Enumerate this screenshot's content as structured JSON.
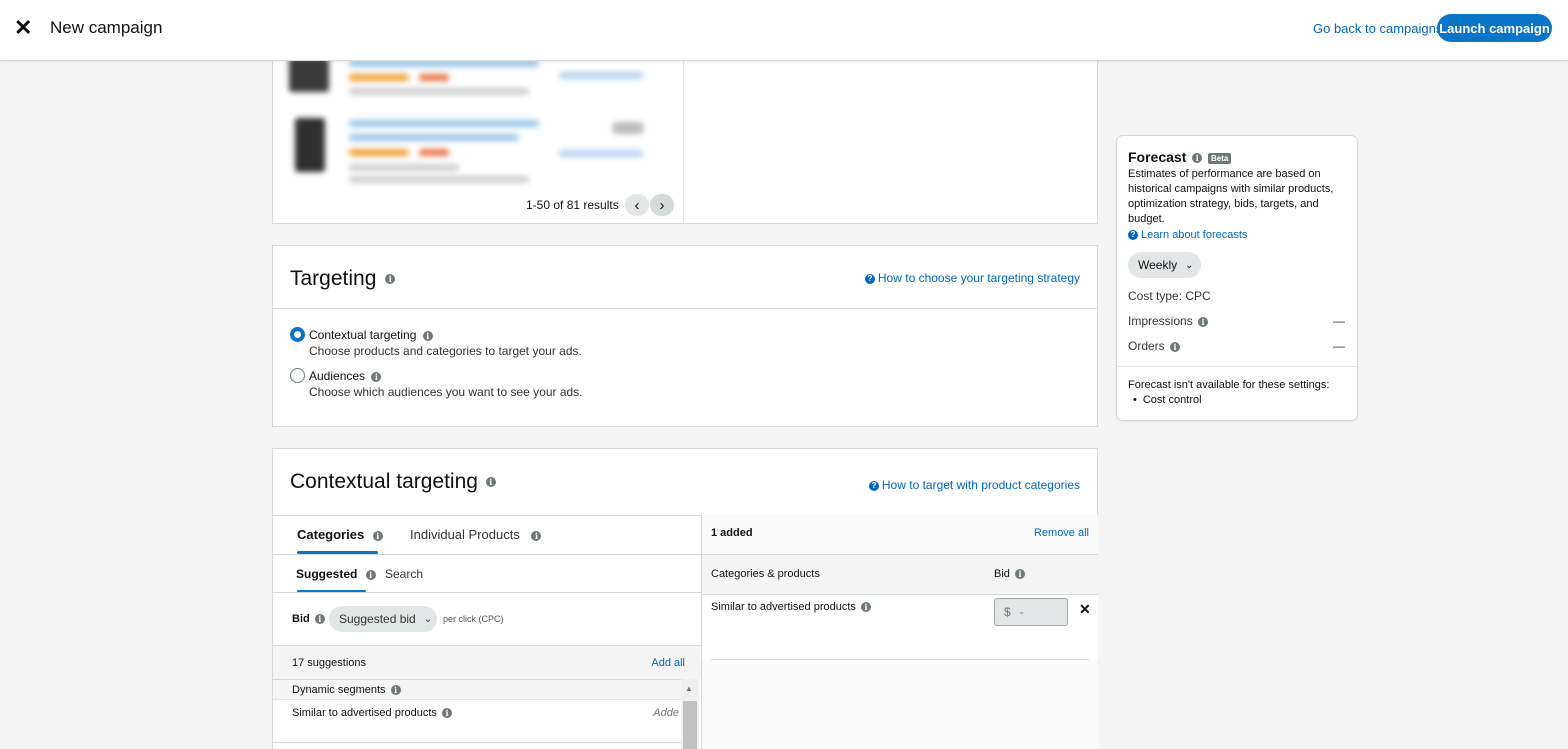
{
  "header": {
    "title": "New campaign",
    "go_back_label": "Go back to campaigns",
    "launch_label": "Launch campaign"
  },
  "products": {
    "pager_text": "1-50 of 81 results"
  },
  "targeting": {
    "title": "Targeting",
    "help_link": "How to choose your targeting strategy",
    "options": [
      {
        "label": "Contextual targeting",
        "desc": "Choose products and categories to target your ads.",
        "checked": true
      },
      {
        "label": "Audiences",
        "desc": "Choose which audiences you want to see your ads.",
        "checked": false
      }
    ]
  },
  "contextual": {
    "title": "Contextual targeting",
    "help_link": "How to target with product categories",
    "tabs": {
      "categories": "Categories",
      "individual": "Individual Products"
    },
    "subtabs": {
      "suggested": "Suggested",
      "search": "Search"
    },
    "bid_label": "Bid",
    "bid_select": "Suggested bid",
    "per_click": "per click (CPC)",
    "suggestions_count": "17 suggestions",
    "add_all": "Add all",
    "group_header": "Dynamic segments",
    "row_label": "Similar to advertised products",
    "row_action": "Adde",
    "right": {
      "added": "1 added",
      "remove_all": "Remove all",
      "col_categories": "Categories & products",
      "col_bid": "Bid",
      "item_label": "Similar to advertised products",
      "bid_currency": "$",
      "bid_value": "-"
    }
  },
  "forecast": {
    "title": "Forecast",
    "beta": "Beta",
    "description": "Estimates of performance are based on historical campaigns with similar products, optimization strategy, bids, targets, and budget.",
    "learn_link": "Learn about forecasts",
    "period": "Weekly",
    "cost_type": "Cost type: CPC",
    "impressions_label": "Impressions",
    "impressions_value": "—",
    "orders_label": "Orders",
    "orders_value": "—",
    "unavailable_note": "Forecast isn't available for these settings:",
    "unavailable_items": [
      "Cost control"
    ]
  }
}
